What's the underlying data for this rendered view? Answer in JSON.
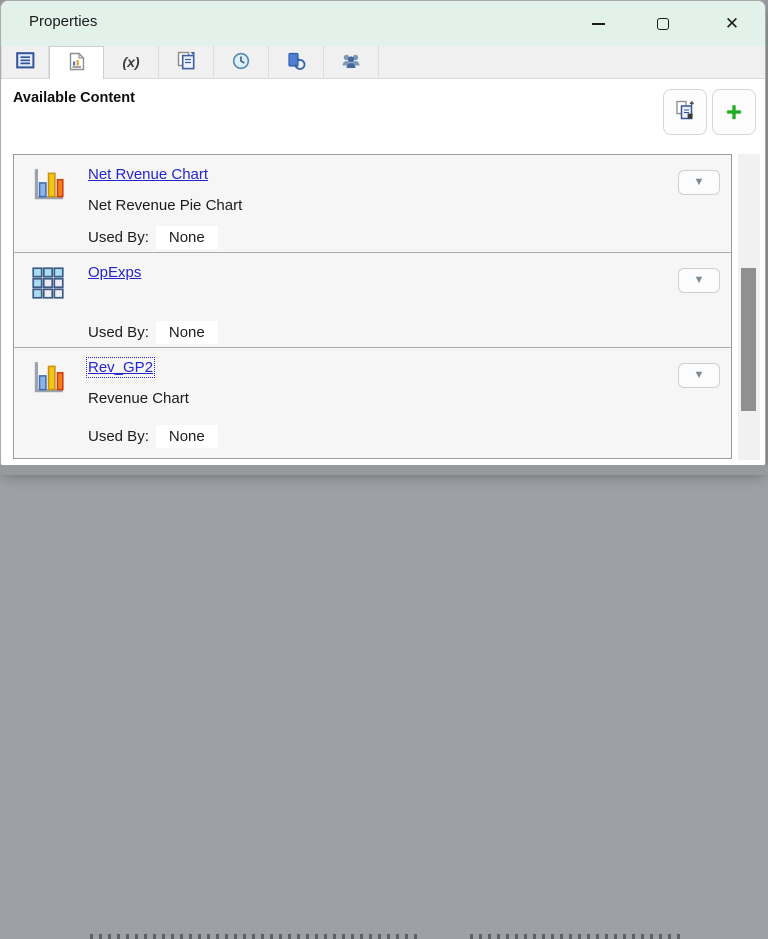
{
  "window": {
    "title": "Properties"
  },
  "tabs": {
    "items": [
      {
        "name": "list-view",
        "selected": false
      },
      {
        "name": "available-content",
        "selected": true
      },
      {
        "name": "functions",
        "selected": false,
        "label": "(x)"
      },
      {
        "name": "copy-content",
        "selected": false
      },
      {
        "name": "history",
        "selected": false
      },
      {
        "name": "refresh-links",
        "selected": false
      },
      {
        "name": "users",
        "selected": false
      }
    ]
  },
  "content": {
    "heading": "Available Content",
    "toolbar": {
      "paste_button": {
        "icon": "paste-content-icon"
      },
      "add_button": {
        "icon": "add-plus-icon",
        "glyph": "+"
      }
    },
    "items": [
      {
        "icon": "bar-chart-icon",
        "title": "Net Rvenue Chart",
        "description": "Net Revenue Pie Chart",
        "used_by_label": "Used By:",
        "used_by_value": "None"
      },
      {
        "icon": "grid-icon",
        "title": "OpExps",
        "description": "",
        "used_by_label": "Used By:",
        "used_by_value": "None"
      },
      {
        "icon": "bar-chart-icon",
        "title": "Rev_GP2",
        "description": "Revenue Chart",
        "used_by_label": "Used By:",
        "used_by_value": "None",
        "focused": true
      }
    ]
  },
  "colors": {
    "titlebar": "#e2f1e9",
    "link": "#2424cd",
    "add_plus": "#1fad1f",
    "scroll_thumb": "#909090"
  }
}
